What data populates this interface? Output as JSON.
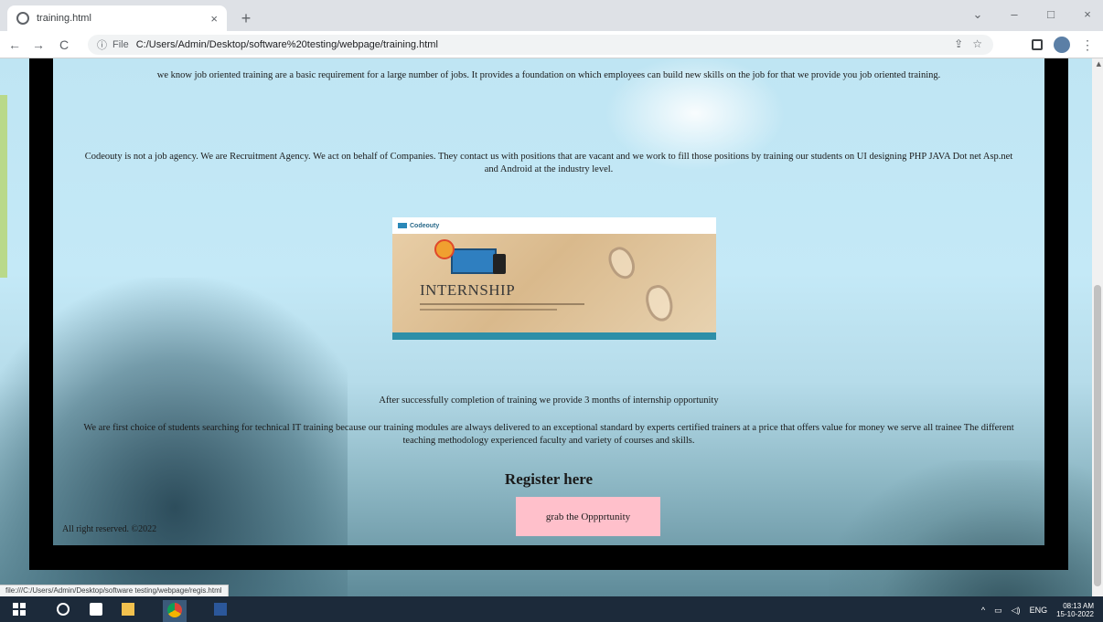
{
  "browser": {
    "tab_title": "training.html",
    "tab_close": "×",
    "new_tab": "+",
    "window_controls": [
      "⌄",
      "–",
      "□",
      "×"
    ],
    "nav": {
      "back": "←",
      "forward": "→",
      "reload": "C"
    },
    "address": {
      "info_icon": "ⓘ",
      "prefix": "File",
      "url": "C:/Users/Admin/Desktop/software%20testing/webpage/training.html"
    },
    "menu": "⋮"
  },
  "page": {
    "paragraphs": [
      "we know job oriented training are a basic requirement for a large number of jobs. It provides a foundation on which employees can build new skills on the job for that we provide you job oriented training.",
      "Codeouty is not a job agency. We are Recruitment Agency. We act on behalf of Companies. They contact us with positions that are vacant and we work to fill those positions by training our students on UI designing PHP JAVA Dot net Asp.net and Android at the industry level.",
      "After successfully completion of training we provide 3 months of internship opportunity",
      "We are first choice of students searching for technical IT training because our training modules are always delivered to an exceptional standard by experts certified trainers at a price that offers value for money we serve all trainee The different teaching methodology experienced faculty and variety of courses and skills."
    ],
    "banner": {
      "logo": "Codeouty",
      "title": "INTERNSHIP"
    },
    "register_heading": "Register here",
    "opportunity_button": "grab the Oppprtunity",
    "copyright": "All right reserved. ©2022"
  },
  "status_bar": {
    "url": "file:///C:/Users/Admin/Desktop/software testing/webpage/regis.html"
  },
  "taskbar": {
    "tray": {
      "arrow": "^",
      "battery": "▭",
      "sound": "◁)",
      "lang": "ENG"
    },
    "clock": {
      "time": "08:13 AM",
      "date": "15-10-2022"
    }
  },
  "colors": {
    "page_bg": "#c4e9f7",
    "frame": "#000000",
    "button_bg": "#ffc0cb",
    "taskbar": "#1c2a3a"
  }
}
